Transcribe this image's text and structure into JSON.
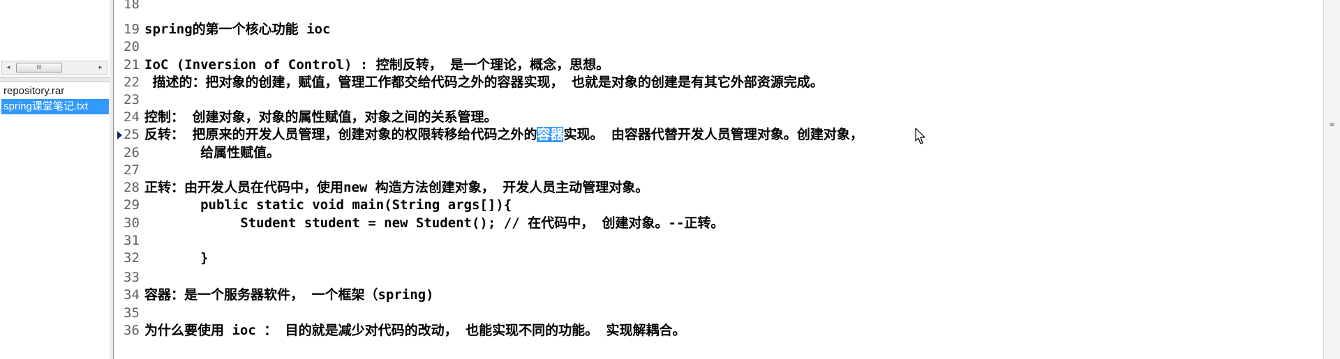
{
  "sidebar": {
    "scroll_grip": "III",
    "scroll_left_arrow": "◂",
    "scroll_right_arrow": "▸",
    "files": [
      {
        "name": "repository.rar",
        "selected": false
      },
      {
        "name": "spring课堂笔记.txt",
        "selected": true
      }
    ]
  },
  "editor": {
    "current_line": 25,
    "lines": [
      {
        "num": "18",
        "text": ""
      },
      {
        "num": "19",
        "text": "spring的第一个核心功能 ioc"
      },
      {
        "num": "20",
        "text": ""
      },
      {
        "num": "21",
        "text": "IoC (Inversion of Control) : 控制反转， 是一个理论，概念，思想。"
      },
      {
        "num": "22",
        "text": " 描述的：把对象的创建，赋值，管理工作都交给代码之外的容器实现， 也就是对象的创建是有其它外部资源完成。"
      },
      {
        "num": "23",
        "text": ""
      },
      {
        "num": "24",
        "text": "控制： 创建对象，对象的属性赋值，对象之间的关系管理。"
      },
      {
        "num": "25",
        "text_before": "反转： 把原来的开发人员管理，创建对象的权限转移给代码之外的",
        "selected": "容器",
        "text_after": "实现。 由容器代替开发人员管理对象。创建对象，"
      },
      {
        "num": "26",
        "text": "       给属性赋值。"
      },
      {
        "num": "27",
        "text": ""
      },
      {
        "num": "28",
        "text": "正转：由开发人员在代码中，使用new 构造方法创建对象， 开发人员主动管理对象。"
      },
      {
        "num": "29",
        "text": "       public static void main(String args[]){"
      },
      {
        "num": "30",
        "text": "            Student student = new Student(); // 在代码中， 创建对象。--正转。"
      },
      {
        "num": "31",
        "text": ""
      },
      {
        "num": "32",
        "text": "       }"
      },
      {
        "num": "33",
        "text": ""
      },
      {
        "num": "34",
        "text": "容器：是一个服务器软件， 一个框架（spring)"
      },
      {
        "num": "35",
        "text": ""
      },
      {
        "num": "36",
        "text": "为什么要使用 ioc ： 目的就是减少对代码的改动， 也能实现不同的功能。 实现解耦合。"
      }
    ]
  },
  "scrollbar": {
    "grip": "≡"
  },
  "colors": {
    "selection": "#3399ff",
    "line_number": "#606060",
    "gutter_marker": "#0b2a6a"
  }
}
